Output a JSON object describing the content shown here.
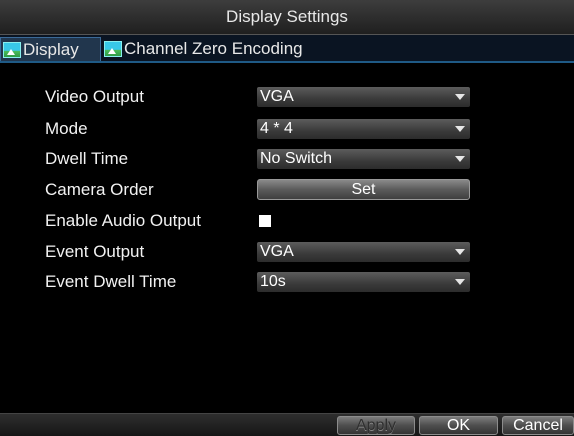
{
  "window": {
    "title": "Display Settings"
  },
  "tabs": [
    {
      "label": "Display",
      "icon": "landscape-icon",
      "active": true
    },
    {
      "label": "Channel Zero Encoding",
      "icon": "landscape-icon",
      "active": false
    }
  ],
  "settings": {
    "video_output": {
      "label": "Video Output",
      "value": "VGA"
    },
    "mode": {
      "label": "Mode",
      "value": "4 * 4"
    },
    "dwell_time": {
      "label": "Dwell Time",
      "value": "No Switch"
    },
    "camera_order": {
      "label": "Camera Order",
      "button": "Set"
    },
    "enable_audio_output": {
      "label": "Enable Audio Output",
      "checked": false
    },
    "event_output": {
      "label": "Event Output",
      "value": "VGA"
    },
    "event_dwell_time": {
      "label": "Event Dwell Time",
      "value": "10s"
    }
  },
  "footer": {
    "apply": "Apply",
    "ok": "OK",
    "cancel": "Cancel"
  },
  "colors": {
    "background": "#000000",
    "tab_accent": "#1f5a86",
    "text": "#ffffff"
  }
}
